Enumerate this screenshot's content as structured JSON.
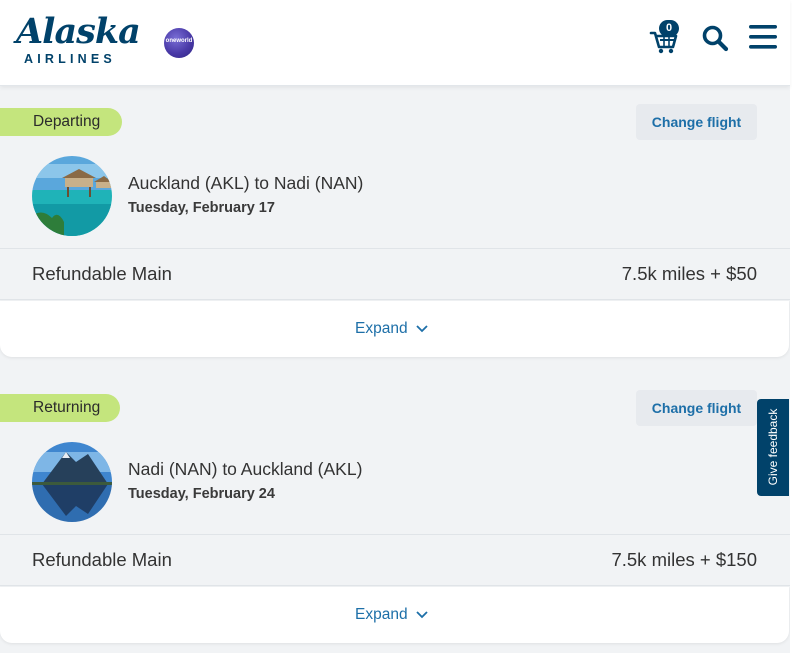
{
  "header": {
    "logo_text": "Alaska",
    "logo_sub": "AIRLINES",
    "partner_logo_text": "oneworld",
    "cart_count": "0",
    "brand_color": "#01426a"
  },
  "trips": [
    {
      "tag": "Departing",
      "change_label": "Change flight",
      "route": "Auckland (AKL) to Nadi (NAN)",
      "date": "Tuesday, February 17",
      "fare_name": "Refundable Main",
      "fare_price": "7.5k miles + $50",
      "expand_label": "Expand",
      "image": "overwater-bungalow"
    },
    {
      "tag": "Returning",
      "change_label": "Change flight",
      "route": "Nadi (NAN) to Auckland (AKL)",
      "date": "Tuesday, February 24",
      "fare_name": "Refundable Main",
      "fare_price": "7.5k miles + $150",
      "expand_label": "Expand",
      "image": "mountain-lake"
    }
  ],
  "feedback_label": "Give feedback",
  "colors": {
    "tag_green": "#c4e57d",
    "link_blue": "#1d6fa8",
    "page_bg": "#f1f3f5"
  }
}
